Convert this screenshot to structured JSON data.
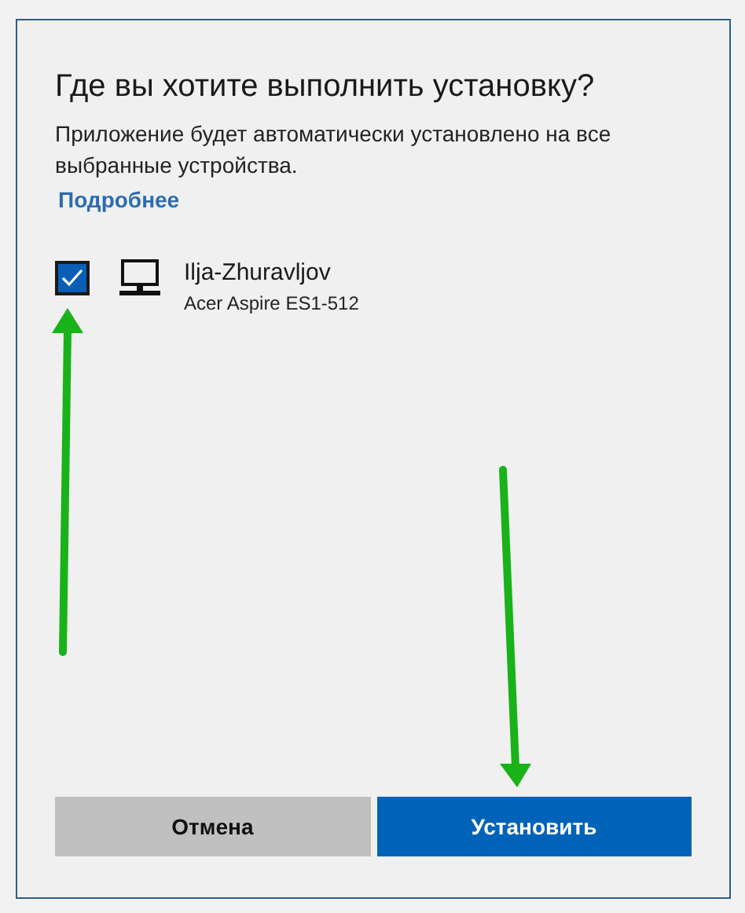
{
  "dialog": {
    "title": "Где вы хотите выполнить установку?",
    "description": "Приложение будет автоматически установлено на все выбранные устройства.",
    "link": "Подробнее",
    "devices": [
      {
        "name": "Ilja-Zhuravljov",
        "model": "Acer Aspire ES1-512",
        "checked": true
      }
    ],
    "buttons": [
      {
        "label": "Отмена",
        "kind": "secondary"
      },
      {
        "label": "Установить",
        "kind": "primary"
      }
    ]
  }
}
